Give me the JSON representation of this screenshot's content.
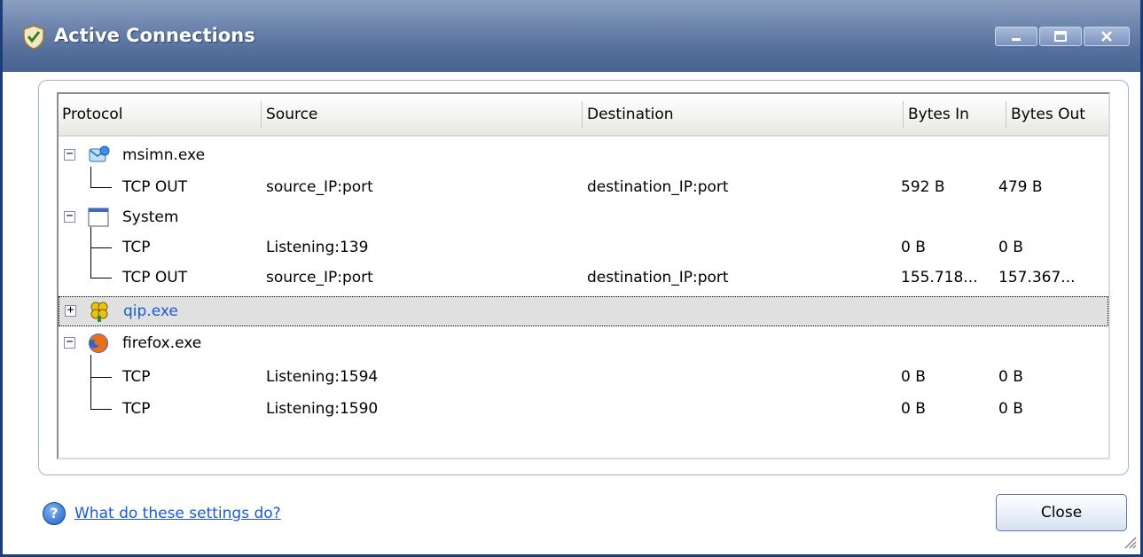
{
  "window": {
    "title": "Active Connections",
    "controls": {
      "minimize": "minimize",
      "maximize": "maximize",
      "close": "close"
    }
  },
  "table": {
    "columns": [
      "Protocol",
      "Source",
      "Destination",
      "Bytes In",
      "Bytes Out"
    ],
    "rows": [
      {
        "type": "process",
        "name": "msimn.exe",
        "expanded": true,
        "icon": "outlook-express-icon"
      },
      {
        "type": "connection",
        "protocol": "TCP OUT",
        "source": "source_IP:port",
        "destination": "destination_IP:port",
        "bytes_in": "592 B",
        "bytes_out": "479 B",
        "last": true
      },
      {
        "type": "process",
        "name": "System",
        "expanded": true,
        "icon": "system-window-icon"
      },
      {
        "type": "connection",
        "protocol": "TCP",
        "source": "Listening:139",
        "destination": "",
        "bytes_in": "0 B",
        "bytes_out": "0 B",
        "last": false
      },
      {
        "type": "connection",
        "protocol": "TCP OUT",
        "source": "source_IP:port",
        "destination": "destination_IP:port",
        "bytes_in": "155.718...",
        "bytes_out": "157.367...",
        "last": true
      },
      {
        "type": "process",
        "name": "qip.exe",
        "expanded": false,
        "icon": "qip-flower-icon",
        "selected": true
      },
      {
        "type": "process",
        "name": "firefox.exe",
        "expanded": true,
        "icon": "firefox-icon"
      },
      {
        "type": "connection",
        "protocol": "TCP",
        "source": "Listening:1594",
        "destination": "",
        "bytes_in": "0 B",
        "bytes_out": "0 B",
        "last": false
      },
      {
        "type": "connection",
        "protocol": "TCP",
        "source": "Listening:1590",
        "destination": "",
        "bytes_in": "0 B",
        "bytes_out": "0 B",
        "last": true
      }
    ]
  },
  "footer": {
    "help_link": "What do these settings do?",
    "close_label": "Close"
  },
  "colors": {
    "titlebar": "#6f86ae",
    "link": "#1a5ad6",
    "selected_row": "#e0e0e0"
  }
}
